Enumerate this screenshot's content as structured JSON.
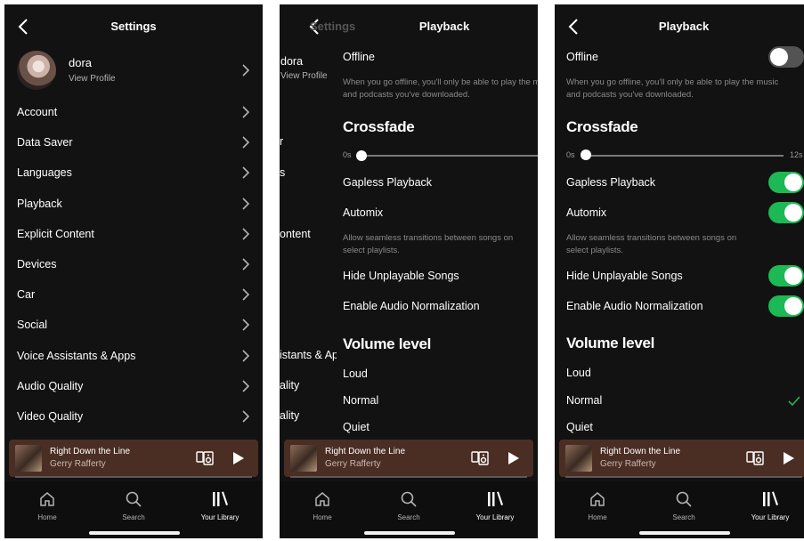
{
  "settings": {
    "title": "Settings",
    "profile": {
      "name": "dora",
      "sub": "View Profile"
    },
    "items": [
      {
        "label": "Account"
      },
      {
        "label": "Data Saver"
      },
      {
        "label": "Languages"
      },
      {
        "label": "Playback"
      },
      {
        "label": "Explicit Content"
      },
      {
        "label": "Devices"
      },
      {
        "label": "Car"
      },
      {
        "label": "Social"
      },
      {
        "label": "Voice Assistants & Apps"
      },
      {
        "label": "Audio Quality"
      },
      {
        "label": "Video Quality"
      }
    ]
  },
  "playback": {
    "title": "Playback",
    "transition_ghost_title": "Settings",
    "offline": {
      "label": "Offline",
      "desc_line1": "When you go offline, you'll only be able to play the music",
      "desc_line2": "and podcasts you've downloaded.",
      "on": false
    },
    "crossfade": {
      "heading": "Crossfade",
      "min": "0s",
      "max": "12s",
      "value_seconds": 0
    },
    "gapless": {
      "label": "Gapless Playback",
      "on": true
    },
    "automix": {
      "label": "Automix",
      "desc_line1": "Allow seamless transitions between songs on",
      "desc_line2": "select playlists.",
      "on": true
    },
    "hide_unplayable": {
      "label": "Hide Unplayable Songs",
      "on": true
    },
    "normalization": {
      "label": "Enable Audio Normalization",
      "on": true
    },
    "volume": {
      "heading": "Volume level",
      "options": [
        "Loud",
        "Normal",
        "Quiet"
      ],
      "selected": "Normal"
    },
    "ghost": {
      "name": "dora",
      "sub": "View Profile",
      "r1": "r",
      "r2": "s",
      "r3": "ontent",
      "r4": "istants & Ap",
      "r5": "ality",
      "r6": "ality"
    }
  },
  "now_playing": {
    "song": "Right Down the Line",
    "artist": "Gerry Rafferty",
    "progress": 0.0
  },
  "nav": {
    "home": "Home",
    "search": "Search",
    "library": "Your Library"
  },
  "colors": {
    "background": "#121212",
    "accent": "#1db954",
    "now_playing_bg": "#4a2e24"
  }
}
